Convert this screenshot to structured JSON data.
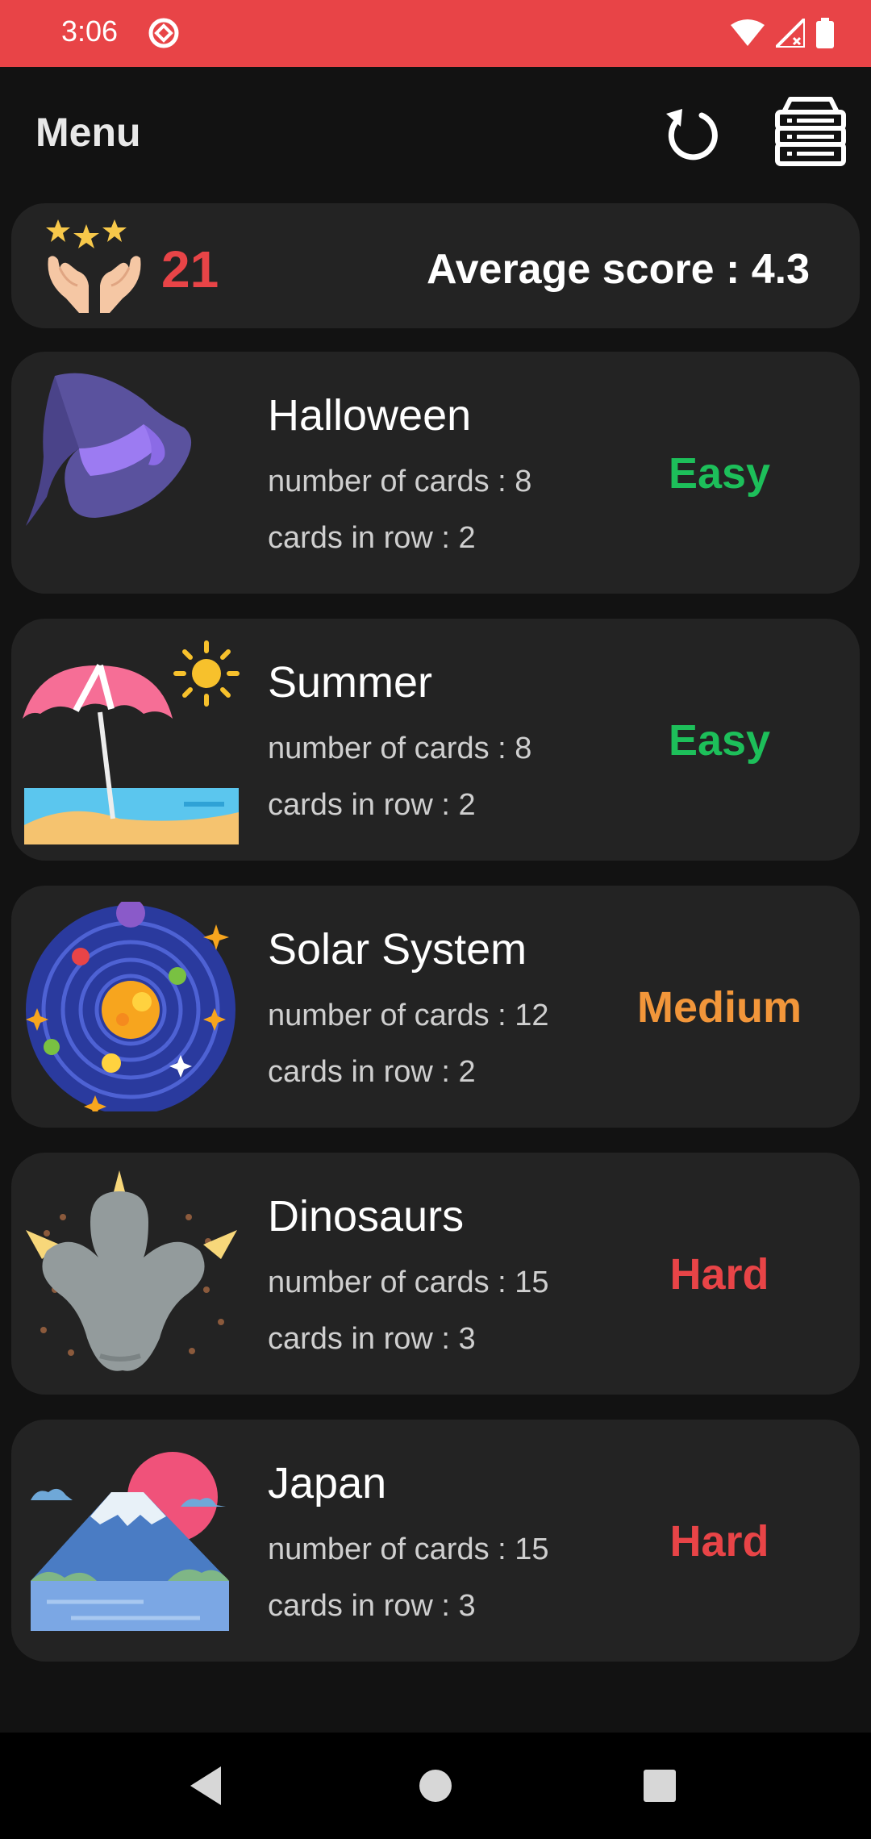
{
  "status_bar": {
    "time": "3:06"
  },
  "app_bar": {
    "title": "Menu"
  },
  "score": {
    "total": "21",
    "average_label": "Average score : 4.3"
  },
  "levels": [
    {
      "title": "Halloween",
      "cards": "number of cards : 8",
      "row": "cards in row : 2",
      "difficulty": "Easy",
      "color": "#1DBF5A"
    },
    {
      "title": "Summer",
      "cards": "number of cards : 8",
      "row": "cards in row : 2",
      "difficulty": "Easy",
      "color": "#1DBF5A"
    },
    {
      "title": "Solar System",
      "cards": "number of cards : 12",
      "row": "cards in row : 2",
      "difficulty": "Medium",
      "color": "#F2963A"
    },
    {
      "title": "Dinosaurs",
      "cards": "number of cards : 15",
      "row": "cards in row : 3",
      "difficulty": "Hard",
      "color": "#E84447"
    },
    {
      "title": "Japan",
      "cards": "number of cards : 15",
      "row": "cards in row : 3",
      "difficulty": "Hard",
      "color": "#E84447"
    }
  ],
  "icons": {
    "refresh": "refresh-icon",
    "records": "stack-icon",
    "back": "back-triangle-icon",
    "home": "home-circle-icon",
    "recents": "recents-square-icon"
  },
  "colors": {
    "status_bar": "#E84447",
    "background": "#121212",
    "card": "#232323"
  }
}
